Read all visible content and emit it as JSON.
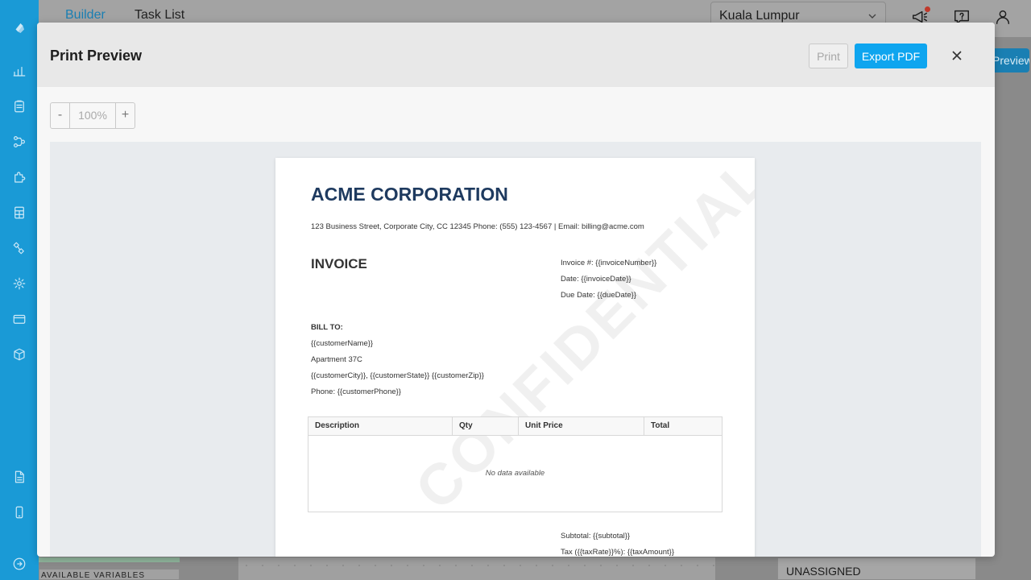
{
  "app": {
    "tabs": [
      "Builder",
      "Task List"
    ],
    "location": "Kuala Lumpur",
    "bg_preview_btn": "Preview",
    "bg_vars_label": "AVAILABLE VARIABLES",
    "bg_assignee": "UNASSIGNED"
  },
  "modal": {
    "title": "Print Preview",
    "print_label": "Print",
    "export_label": "Export PDF",
    "zoom_out": "-",
    "zoom_value": "100%",
    "zoom_in": "+"
  },
  "invoice": {
    "company": "ACME CORPORATION",
    "address": "123 Business Street, Corporate City, CC 12345 Phone: (555) 123-4567 | Email: billing@acme.com",
    "title": "INVOICE",
    "number": "Invoice #: {{invoiceNumber}}",
    "date": "Date: {{invoiceDate}}",
    "due": "Due Date: {{dueDate}}",
    "bill_to_heading": "BILL TO:",
    "bill_to": [
      "{{customerName}}",
      "Apartment 37C",
      "{{customerCity}}, {{customerState}} {{customerZip}}",
      "Phone: {{customerPhone}}"
    ],
    "columns": [
      "Description",
      "Qty",
      "Unit Price",
      "Total"
    ],
    "empty_text": "No data available",
    "subtotal": "Subtotal: {{subtotal}}",
    "tax": "Tax ({{taxRate}}%): {{taxAmount}}",
    "watermark": "CONFIDENTIAL"
  }
}
